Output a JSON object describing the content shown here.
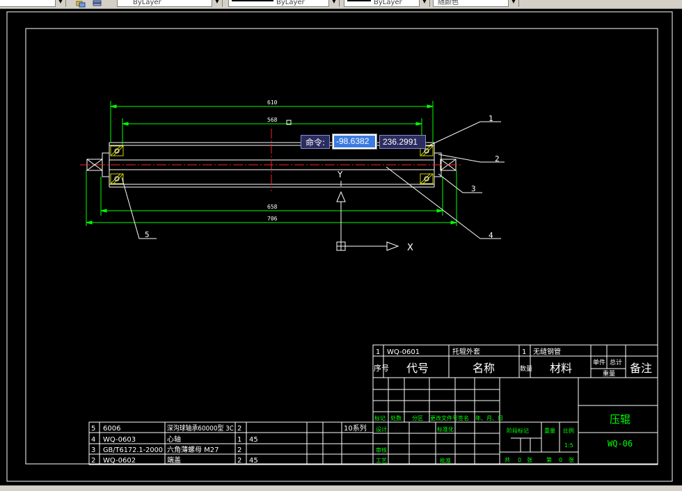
{
  "toolbar": {
    "layer_combo": "ByLayer",
    "linetype_combo": "ByLayer",
    "lineweight_combo": "ByLayer",
    "color_combo": "随颜色"
  },
  "drawing": {
    "dim_610": "610",
    "dim_568": "568",
    "dim_658": "658",
    "dim_706": "706",
    "leader_1": "1",
    "leader_2": "2",
    "leader_3": "3",
    "leader_4": "4",
    "leader_5": "5",
    "ucs_y": "Y",
    "ucs_x": "X"
  },
  "command_input": {
    "label": "命令:",
    "x_value": "-98.6382",
    "y_value": "236.2991"
  },
  "parts_list_top": {
    "row": [
      "1",
      "WQ-0601",
      "托辊外套",
      "1",
      "无缝钢管"
    ],
    "headers": {
      "seq": "序号",
      "code": "代号",
      "name": "名称",
      "qty": "数量",
      "material": "材料",
      "single": "单件",
      "total": "总计",
      "weight": "重量",
      "remark": "备注"
    }
  },
  "parts_list_bottom": [
    {
      "seq": "5",
      "code": "6006",
      "name": "深沟球轴承60000型 3C",
      "qty": "2",
      "material": "",
      "note": "10系列"
    },
    {
      "seq": "4",
      "code": "WQ-0603",
      "name": "心轴",
      "qty": "1",
      "material": "45",
      "note": ""
    },
    {
      "seq": "3",
      "code": "GB/T6172.1-2000",
      "name": "六角薄螺母 M27",
      "qty": "2",
      "material": "",
      "note": ""
    },
    {
      "seq": "2",
      "code": "WQ-0602",
      "name": "端盖",
      "qty": "2",
      "material": "45",
      "note": ""
    }
  ],
  "title_block": {
    "mark": "标记",
    "count": "处数",
    "zone": "分区",
    "change_doc": "更改文件号",
    "sign": "签名",
    "date": "年、月、日",
    "design": "设计",
    "standardize": "标准化",
    "review": "审核",
    "process": "工艺",
    "approve": "批准",
    "stage_mark": "阶段标记",
    "weight": "重量",
    "scale": "比例",
    "scale_value": "1:5",
    "total_sheets": "共",
    "sheet_label": "张",
    "sheet_no": "第",
    "sheets_value": "0",
    "sheet_value": "0",
    "drawing_name": "压辊",
    "drawing_code": "WQ-06"
  }
}
